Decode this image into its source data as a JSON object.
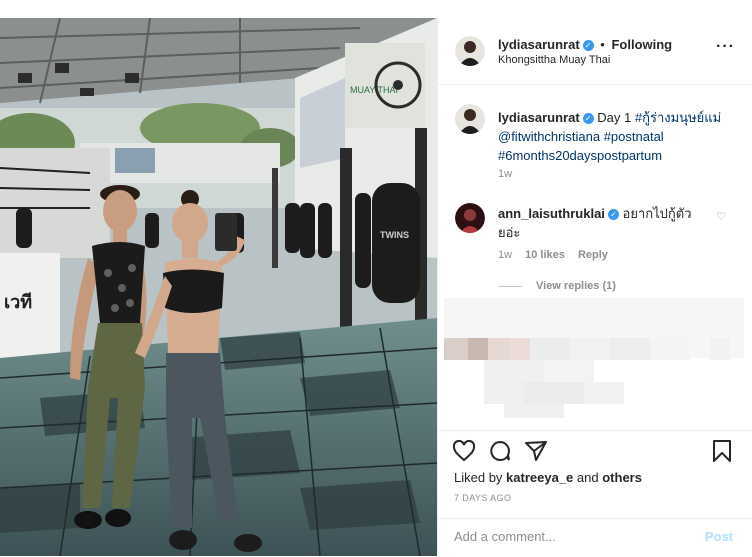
{
  "post": {
    "author": {
      "username": "lydiasarunrat",
      "verified": true,
      "follow_state": "Following",
      "separator": "•"
    },
    "location": "Khongsittha Muay Thai",
    "more_icon": "more-horizontal-icon",
    "caption": {
      "username": "lydiasarunrat",
      "text_parts": [
        "Day 1",
        "#กู้ร่างมนุษย์แม่",
        "@fitwithchristiana",
        "#postnatal",
        "#6months20dayspostpartum"
      ],
      "time": "1w"
    },
    "comment": {
      "username": "ann_laisuthruklai",
      "verified": true,
      "text": "อยากไปกู้ตัวยอ่ะ",
      "time": "1w",
      "likes": "10 likes",
      "reply_label": "Reply",
      "view_replies": "View replies (1)"
    },
    "actions": {
      "like_icon": "heart-icon",
      "comment_icon": "comment-icon",
      "share_icon": "share-icon",
      "save_icon": "bookmark-icon"
    },
    "likes": {
      "prefix": "Liked by",
      "user": "katreeya_e",
      "middle": "and",
      "suffix": "others"
    },
    "date": "7 DAYS AGO",
    "add_comment": {
      "placeholder": "Add a comment...",
      "post_label": "Post"
    },
    "colors": {
      "link": "#003569",
      "verified": "#3897f0",
      "post_disabled": "#b2dffc",
      "muted": "#8e8e8e"
    },
    "photo_text": {
      "left_bag": "TWINS",
      "right_bag": "TWINS",
      "ring_banner": "เวที",
      "wall_banner": "MUAY THAI"
    }
  }
}
